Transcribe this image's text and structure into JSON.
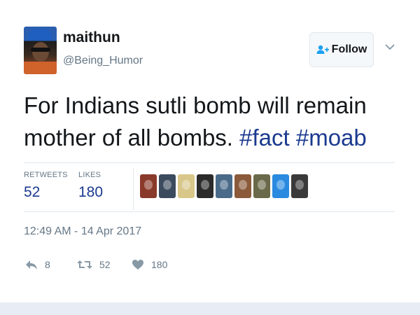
{
  "user": {
    "display_name": "maithun",
    "handle": "@Being_Humor"
  },
  "follow_button": {
    "label": "Follow"
  },
  "tweet": {
    "text_plain": "For Indians sutli bomb will remain mother of all bombs.",
    "hashtags": [
      "#fact",
      "#moab"
    ]
  },
  "stats": {
    "retweets_label": "RETWEETS",
    "retweets_value": "52",
    "likes_label": "LIKES",
    "likes_value": "180"
  },
  "likers": [
    {
      "color": "#8a3a2a"
    },
    {
      "color": "#3c4a5e"
    },
    {
      "color": "#d9c78a"
    },
    {
      "color": "#2b2b2b"
    },
    {
      "color": "#4a6a8a"
    },
    {
      "color": "#8a5a3a"
    },
    {
      "color": "#6a6a4a"
    },
    {
      "color": "#2a8ae0"
    },
    {
      "color": "#3a3a3a"
    }
  ],
  "timestamp": "12:49 AM - 14 Apr 2017",
  "actions": {
    "reply_count": "8",
    "retweet_count": "52",
    "like_count": "180"
  },
  "colors": {
    "link": "#1b3a8f",
    "secondary_text": "#657786",
    "border": "#e1e8ed"
  }
}
